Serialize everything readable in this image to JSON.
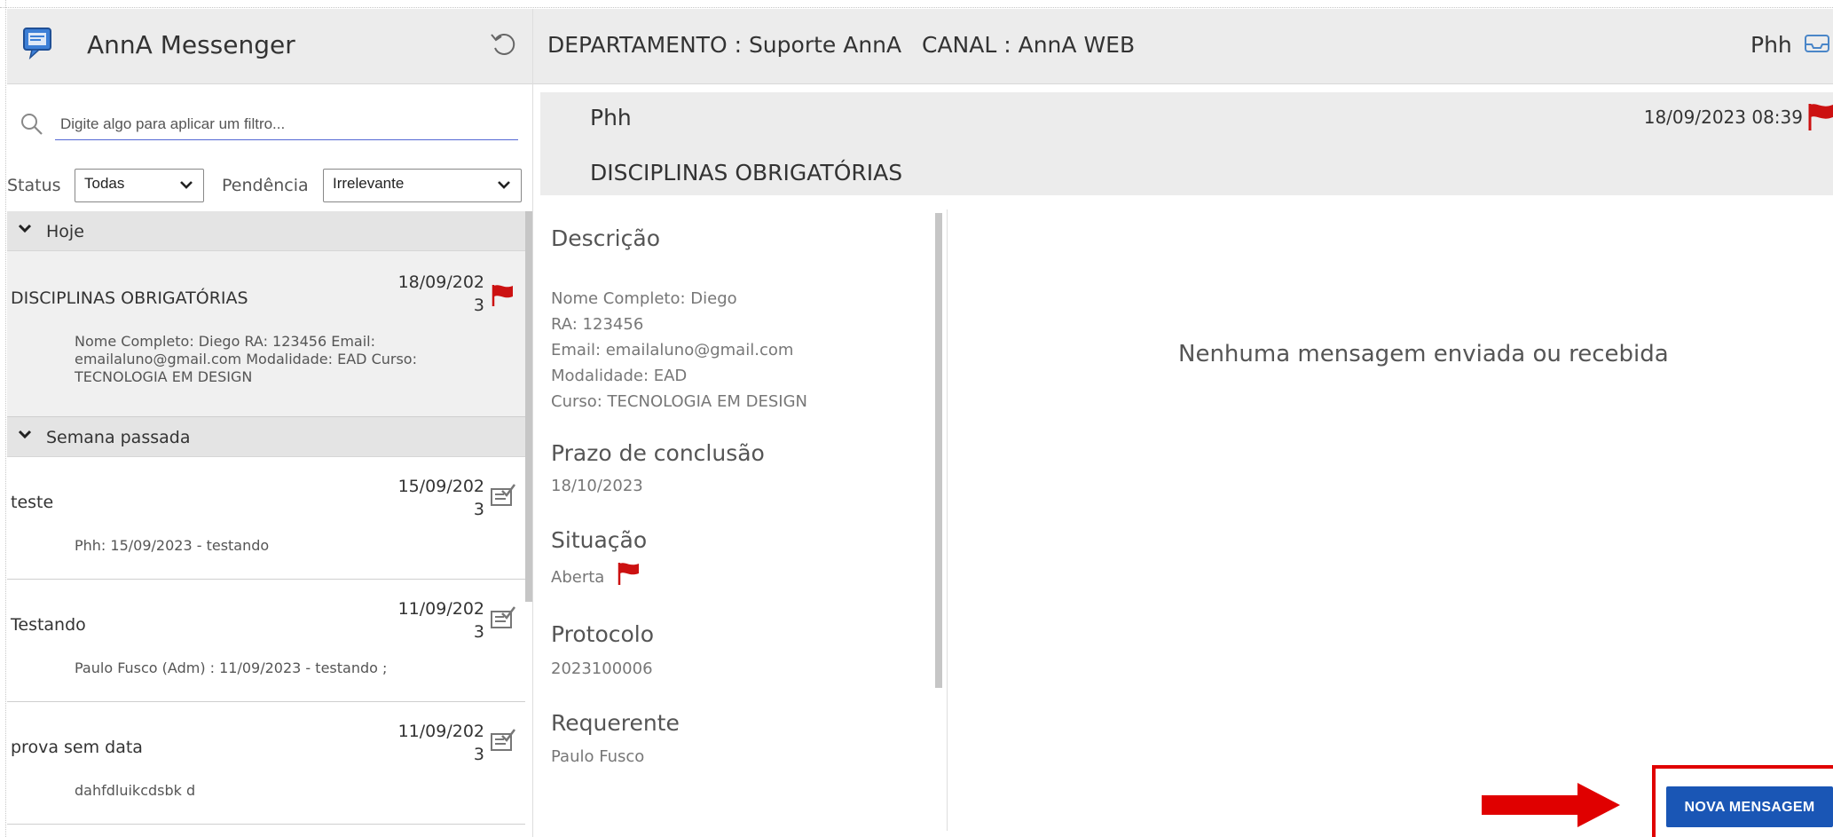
{
  "app": {
    "title": "AnnA Messenger",
    "icon": "chat-bubble-icon"
  },
  "search": {
    "placeholder": "Digite algo para aplicar um filtro..."
  },
  "filters": {
    "status_label": "Status",
    "status_value": "Todas",
    "pendencia_label": "Pendência",
    "pendencia_value": "Irrelevante"
  },
  "groups": [
    {
      "label": "Hoje",
      "items": [
        {
          "title": "DISCIPLINAS OBRIGATÓRIAS",
          "date": "18/09/2023",
          "snippet": "Nome Completo: Diego RA: 123456 Email: emailaluno@gmail.com Modalidade: EAD Curso: TECNOLOGIA EM DESIGN",
          "icon": "red-flag-icon"
        }
      ]
    },
    {
      "label": "Semana passada",
      "items": [
        {
          "title": "teste",
          "date": "15/09/2023",
          "snippet": "Phh: 15/09/2023 - testando",
          "icon": "checked-tray-icon"
        },
        {
          "title": "Testando",
          "date": "11/09/2023",
          "snippet": "Paulo Fusco (Adm) : 11/09/2023 - testando ;",
          "icon": "checked-tray-icon"
        },
        {
          "title": "prova sem data",
          "date": "11/09/2023",
          "snippet": "dahfdluikcdsbk d",
          "icon": "checked-tray-icon"
        }
      ]
    }
  ],
  "header": {
    "departamento": "DEPARTAMENTO : Suporte AnnA",
    "canal": "CANAL : AnnA WEB",
    "user": "Phh"
  },
  "ticket": {
    "name": "Phh",
    "subject": "DISCIPLINAS OBRIGATÓRIAS",
    "datetime": "18/09/2023 08:39"
  },
  "details": {
    "descricao_label": "Descrição",
    "descricao_lines": [
      "Nome Completo: Diego",
      "RA: 123456",
      "Email: emailaluno@gmail.com",
      "Modalidade: EAD",
      "Curso: TECNOLOGIA EM DESIGN"
    ],
    "prazo_label": "Prazo de conclusão",
    "prazo_value": "18/10/2023",
    "situacao_label": "Situação",
    "situacao_value": "Aberta",
    "protocolo_label": "Protocolo",
    "protocolo_value": "2023100006",
    "requerente_label": "Requerente",
    "requerente_value": "Paulo Fusco"
  },
  "messages": {
    "empty_text": "Nenhuma mensagem enviada ou recebida"
  },
  "actions": {
    "nova_mensagem": "NOVA MENSAGEM"
  },
  "colors": {
    "accent": "#1a56b5",
    "flag": "#cc1111",
    "highlight": "#e00000"
  }
}
